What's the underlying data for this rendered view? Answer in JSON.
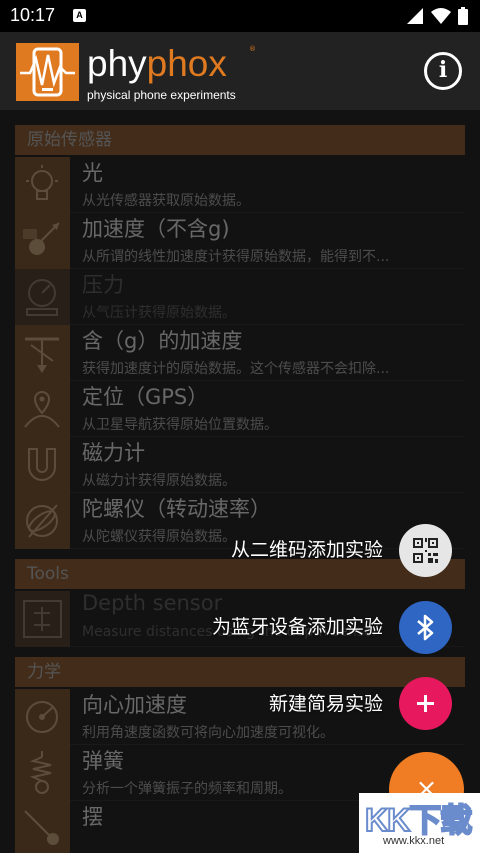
{
  "status_bar": {
    "time": "10:17",
    "notification_letter": "A"
  },
  "app_bar": {
    "logo_phy": "phy",
    "logo_phox": "phox",
    "logo_registered": "®",
    "logo_subtitle": "physical phone experiments",
    "info_label": "i"
  },
  "sections": {
    "raw_sensors": "原始传感器",
    "tools": "Tools",
    "mechanics": "力学"
  },
  "raw_items": [
    {
      "title": "光",
      "desc": "从光传感器获取原始数据。",
      "icon": "lightbulb-icon"
    },
    {
      "title": "加速度（不含g)",
      "desc": "从所谓的线性加速度计获得原始数据，能得到不...",
      "icon": "accelerometer-icon"
    },
    {
      "title": "压力",
      "desc": "从气压计获得原始数据。",
      "icon": "pressure-gauge-icon"
    },
    {
      "title": "含（g）的加速度",
      "desc": "获得加速度计的原始数据。这个传感器不会扣除...",
      "icon": "gravity-acceleration-icon"
    },
    {
      "title": "定位（GPS）",
      "desc": "从卫星导航获得原始位置数据。",
      "icon": "location-globe-icon"
    },
    {
      "title": "磁力计",
      "desc": "从磁力计获得原始数据。",
      "icon": "magnet-icon"
    },
    {
      "title": "陀螺仪（转动速率）",
      "desc": "从陀螺仪获得原始数据。",
      "icon": "gyroscope-icon"
    }
  ],
  "tools_items": [
    {
      "title": "Depth sensor",
      "desc": "Measure distances using the depth sensor",
      "icon": "depth-sensor-icon"
    }
  ],
  "mechanics_items": [
    {
      "title": "向心加速度",
      "desc": "利用角速度函数可将向心加速度可视化。",
      "icon": "centripetal-icon"
    },
    {
      "title": "弹簧",
      "desc": "分析一个弹簧振子的频率和周期。",
      "icon": "spring-icon"
    },
    {
      "title": "摆",
      "desc": "",
      "icon": "pendulum-icon"
    }
  ],
  "fab": {
    "qr_label": "从二维码添加实验",
    "bluetooth_label": "为蓝牙设备添加实验",
    "new_label": "新建简易实验",
    "close_symbol": "×"
  },
  "watermark": {
    "main": "KK下载",
    "url": "www.kkx.net"
  },
  "colors": {
    "accent_orange": "#e07a20",
    "section_brown": "#7a5230",
    "fab_bluetooth": "#2f66c4",
    "fab_new": "#e8185e",
    "fab_qr": "#e6e6e6"
  }
}
